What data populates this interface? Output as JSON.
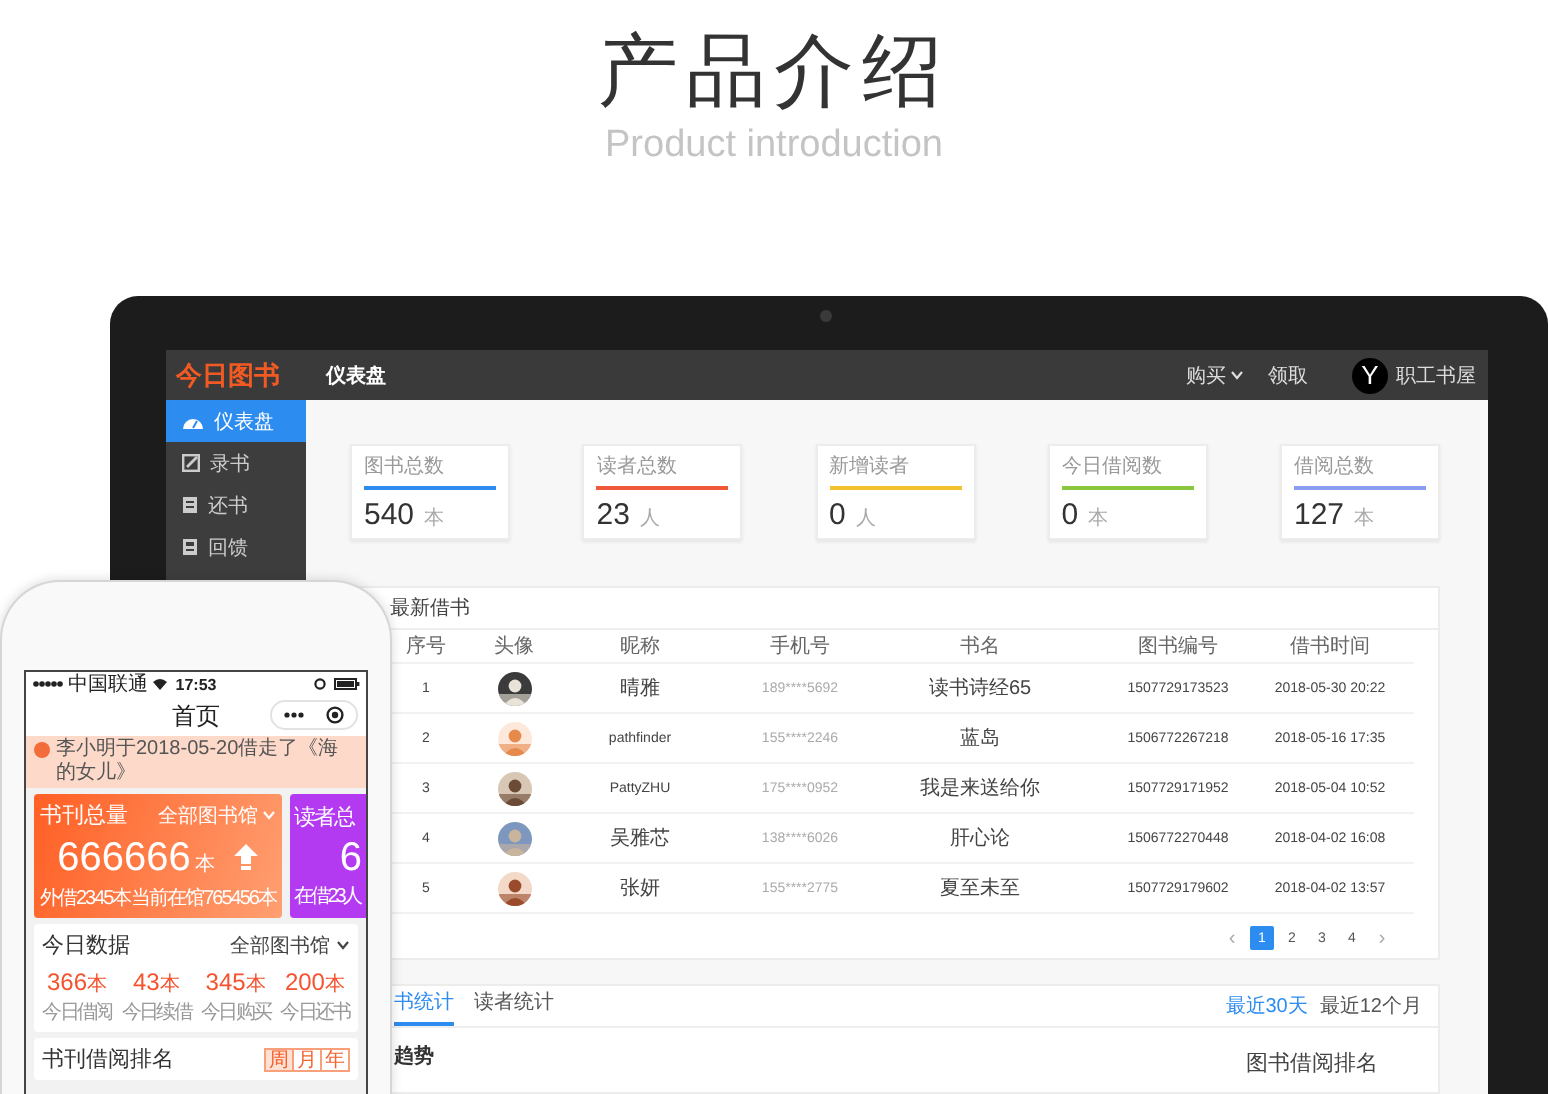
{
  "heading": {
    "title": "产品介绍",
    "subtitle": "Product introduction"
  },
  "laptop": {
    "topbar": {
      "logo": "今日图书",
      "page": "仪表盘",
      "links": [
        {
          "label": "购买",
          "dropdown": true
        },
        {
          "label": "领取",
          "dropdown": false
        }
      ],
      "avatar": "Y",
      "user": "职工书屋"
    },
    "sidebar": [
      {
        "label": "仪表盘",
        "kind": "gauge",
        "selected": true
      },
      {
        "label": "录书",
        "kind": "edit",
        "selected": false
      },
      {
        "label": "还书",
        "kind": "book",
        "selected": false
      },
      {
        "label": "回馈",
        "kind": "document",
        "selected": false
      }
    ],
    "stats": [
      {
        "label": "图书总数",
        "value": "540",
        "unit": "本",
        "color": "#2d8cf0"
      },
      {
        "label": "读者总数",
        "value": "23",
        "unit": "人",
        "color": "#f0583a"
      },
      {
        "label": "新增读者",
        "value": "0",
        "unit": "人",
        "color": "#f2c12e"
      },
      {
        "label": "今日借阅数",
        "value": "0",
        "unit": "本",
        "color": "#8cc63f"
      },
      {
        "label": "借阅总数",
        "value": "127",
        "unit": "本",
        "color": "#8c9cf0"
      }
    ],
    "table": {
      "title": "最新借书",
      "columns": [
        "序号",
        "头像",
        "昵称",
        "手机号",
        "书名",
        "图书编号",
        "借书时间"
      ],
      "rows": [
        {
          "no": "1",
          "nickname": "晴雅",
          "phone": "189****5692",
          "book": "读书诗经65",
          "book_id": "1507729173523",
          "time": "2018-05-30 20:22"
        },
        {
          "no": "2",
          "nickname": "pathfinder",
          "phone": "155****2246",
          "book": "蓝岛",
          "book_id": "1506772267218",
          "time": "2018-05-16 17:35"
        },
        {
          "no": "3",
          "nickname": "PattyZHU",
          "phone": "175****0952",
          "book": "我是来送给你",
          "book_id": "1507729171952",
          "time": "2018-05-04 10:52"
        },
        {
          "no": "4",
          "nickname": "吴雅芯",
          "phone": "138****6026",
          "book": "肝心论",
          "book_id": "1506772270448",
          "time": "2018-04-02 16:08"
        },
        {
          "no": "5",
          "nickname": "张妍",
          "phone": "155****2775",
          "book": "夏至未至",
          "book_id": "1507729179602",
          "time": "2018-04-02 13:57"
        }
      ]
    },
    "pagination": {
      "prev": "‹",
      "next": "›",
      "pages": [
        {
          "label": "1",
          "selected": true
        },
        {
          "label": "2",
          "selected": false
        },
        {
          "label": "3",
          "selected": false
        },
        {
          "label": "4",
          "selected": false
        }
      ]
    },
    "stats_panel": {
      "tabs": [
        {
          "label": "书统计",
          "selected": true
        },
        {
          "label": "读者统计",
          "selected": false
        }
      ],
      "ranges": [
        {
          "label": "最近30天",
          "selected": true
        },
        {
          "label": "最近12个月",
          "selected": false
        }
      ],
      "trend_title": "趋势",
      "ranking_title": "图书借阅排名"
    }
  },
  "phone": {
    "status": {
      "carrier": "中国联通",
      "time": "17:53"
    },
    "nav_title": "首页",
    "notice": "李小明于2018-05-20借走了《海的女儿》",
    "cards": [
      {
        "kind": "books",
        "title": "书刊总量",
        "scope": "全部图书馆",
        "value": "666666",
        "unit": "本",
        "left": "外借2345本",
        "right": "当前在馆765456本"
      },
      {
        "kind": "readers",
        "title": "读者总",
        "value": "6",
        "left": "在借23人"
      }
    ],
    "today": {
      "title": "今日数据",
      "scope": "全部图书馆",
      "items": [
        {
          "value": "366",
          "unit": "本",
          "label": "今日借阅"
        },
        {
          "value": "43",
          "unit": "本",
          "label": "今日续借"
        },
        {
          "value": "345",
          "unit": "本",
          "label": "今日购买"
        },
        {
          "value": "200",
          "unit": "本",
          "label": "今日还书"
        }
      ]
    },
    "ranking": {
      "title": "书刊借阅排名",
      "periods": [
        {
          "label": "周",
          "selected": true
        },
        {
          "label": "月",
          "selected": false
        },
        {
          "label": "年",
          "selected": false
        }
      ]
    }
  }
}
